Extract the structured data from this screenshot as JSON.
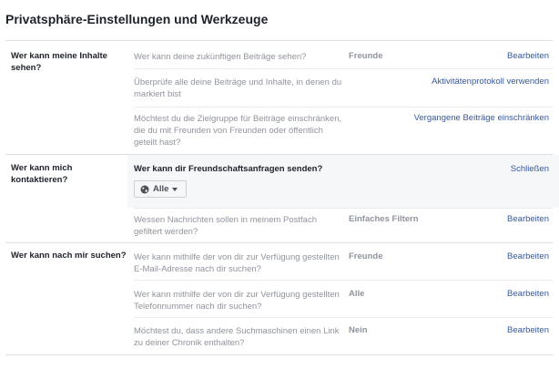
{
  "title": "Privatsphäre-Einstellungen und Werkzeuge",
  "sections": [
    {
      "label": "Wer kann meine Inhalte sehen?",
      "rows": [
        {
          "text": "Wer kann deine zukünftigen Beiträge sehen?",
          "value": "Freunde",
          "action": "Bearbeiten"
        },
        {
          "text": "Überprüfe alle deine Beiträge und Inhalte, in denen du markiert bist",
          "value": "",
          "action": "Aktivitätenprotokoll verwenden"
        },
        {
          "text": "Möchtest du die Zielgruppe für Beiträge einschränken, die du mit Freunden von Freunden oder öffentlich geteilt hast?",
          "value": "",
          "action": "Vergangene Beiträge einschränken"
        }
      ]
    },
    {
      "label": "Wer kann mich kontaktieren?",
      "expanded": {
        "question": "Wer kann dir Freundschaftsanfragen senden?",
        "action": "Schließen",
        "dropdown_value": "Alle",
        "dropdown_icon": "globe-icon"
      },
      "rows": [
        {
          "text": "Wessen Nachrichten sollen in meinem Postfach gefiltert werden?",
          "value": "Einfaches Filtern",
          "action": "Bearbeiten"
        }
      ]
    },
    {
      "label": "Wer kann nach mir suchen?",
      "rows": [
        {
          "text": "Wer kann mithilfe der von dir zur Verfügung gestellten E-Mail-Adresse nach dir suchen?",
          "value": "Freunde",
          "action": "Bearbeiten"
        },
        {
          "text": "Wer kann mithilfe der von dir zur Verfügung gestellten Telefonnummer nach dir suchen?",
          "value": "Alle",
          "action": "Bearbeiten"
        },
        {
          "text": "Möchtest du, dass andere Suchmaschinen einen Link zu deiner Chronik enthalten?",
          "value": "Nein",
          "action": "Bearbeiten"
        }
      ]
    }
  ]
}
